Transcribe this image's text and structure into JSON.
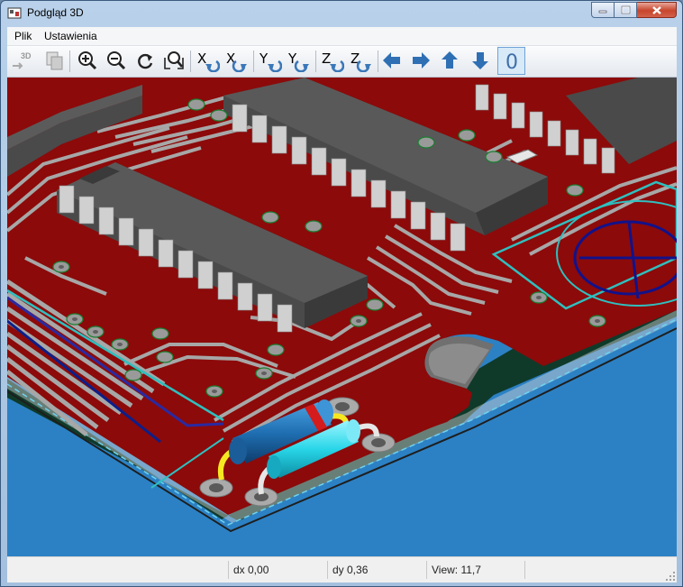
{
  "window": {
    "title": "Podgląd 3D"
  },
  "menu": [
    "Plik",
    "Ustawienia"
  ],
  "toolbar": {
    "axis_x": "X",
    "axis_y": "Y",
    "axis_z": "Z",
    "mode_3d_label": "3D",
    "ortho_label": "0"
  },
  "status": {
    "dx": "dx 0,00",
    "dy": "dy 0,36",
    "view": "View: 11,7"
  },
  "colors": {
    "board": "#8c0a0a",
    "track": "#a7a7a7",
    "background": "#2c81c4",
    "chip": "#4c4c4c"
  }
}
